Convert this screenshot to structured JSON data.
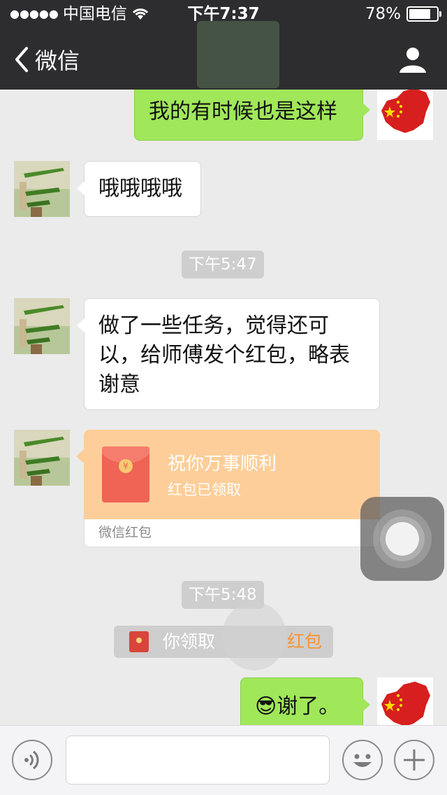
{
  "status_bar": {
    "carrier": "中国电信",
    "time": "下午7:37",
    "battery": "78%",
    "battery_level": 0.78
  },
  "nav": {
    "back_label": "微信"
  },
  "messages": [
    {
      "side": "right",
      "type": "text",
      "text": "我的有时候也是这样"
    },
    {
      "side": "left",
      "type": "text",
      "text": "哦哦哦哦"
    },
    {
      "type": "timestamp",
      "text": "下午5:47"
    },
    {
      "side": "left",
      "type": "text",
      "lines": [
        "做了一些任务，觉得还可",
        "以，给师傅发个红包，略表",
        "谢意"
      ]
    },
    {
      "side": "left",
      "type": "red_packet",
      "title": "祝你万事顺利",
      "status": "红包已领取",
      "footer": "微信红包",
      "coin": "¥"
    },
    {
      "type": "timestamp",
      "text": "下午5:48"
    },
    {
      "type": "system",
      "prefix": "你领取",
      "link": "红包"
    },
    {
      "side": "right",
      "type": "text",
      "emoji": "😎",
      "text": "谢了。"
    }
  ],
  "colors": {
    "topbar": "#2d2d2f",
    "chat_bg": "#ebebeb",
    "bubble_green": "#a0e75a",
    "bubble_white": "#ffffff",
    "packet_orange": "#fdce99",
    "link_orange": "#f69436"
  },
  "icons": {
    "back": "chevron-left-icon",
    "profile": "user-icon",
    "voice": "voice-icon",
    "emoji": "smiley-icon",
    "plus": "plus-icon"
  }
}
